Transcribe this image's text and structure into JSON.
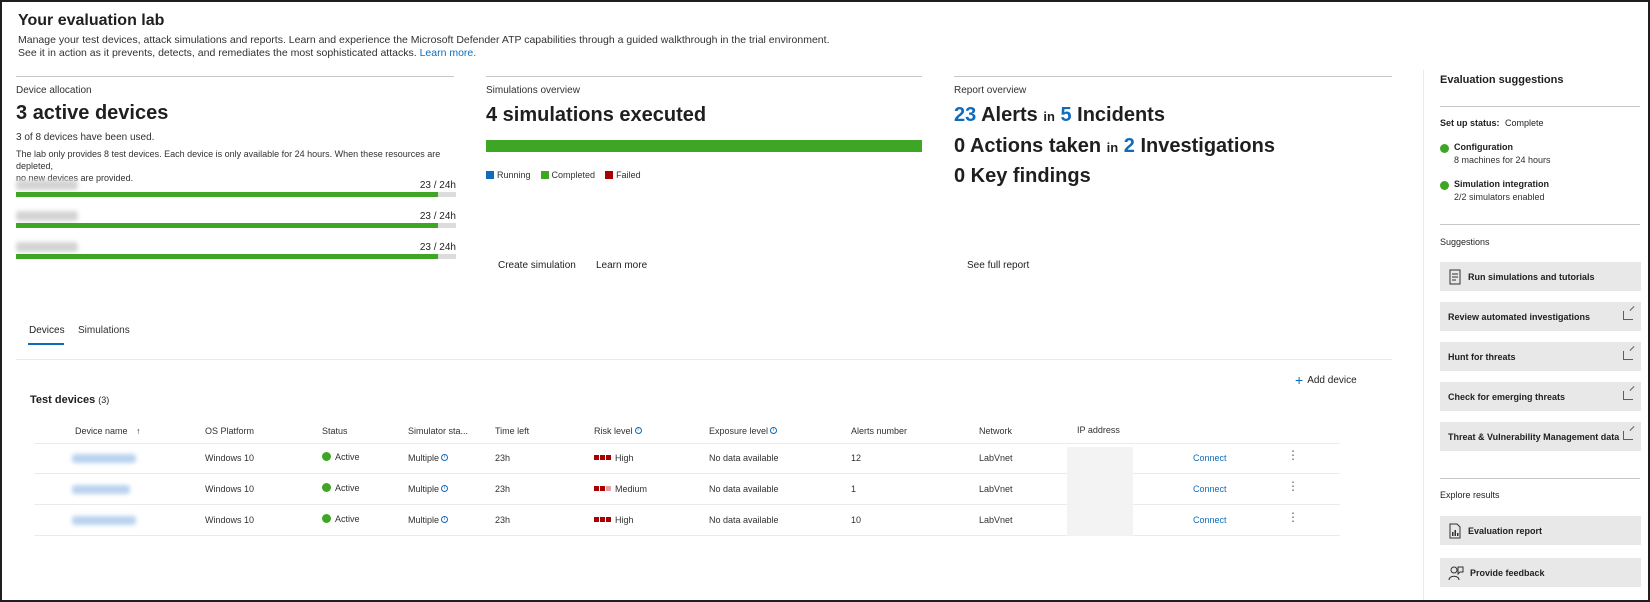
{
  "header": {
    "title": "Your evaluation lab",
    "intro_line1": "Manage your test devices, attack simulations and reports. Learn and experience the Microsoft Defender ATP capabilities through a guided walkthrough in the trial environment.",
    "intro_line2": "See it in action as it prevents, detects, and remediates the most sophisticated attacks.",
    "learn_more": "Learn more."
  },
  "device_allocation": {
    "label": "Device allocation",
    "headline_num": "3",
    "headline_text": "active devices",
    "used_text": "3 of 8 devices have been used.",
    "note_line1": "The lab only provides 8 test devices. Each device is only available for 24 hours. When these resources are depleted,",
    "note_line2": "no new devices are provided.",
    "devices": [
      {
        "time": "23 / 24h",
        "progress": 0.958
      },
      {
        "time": "23 / 24h",
        "progress": 0.958
      },
      {
        "time": "23 / 24h",
        "progress": 0.958
      }
    ]
  },
  "simulations_overview": {
    "label": "Simulations overview",
    "headline": "4 simulations executed",
    "completed_fraction": 1.0,
    "legend": [
      {
        "label": "Running",
        "color": "#0f6cbd"
      },
      {
        "label": "Completed",
        "color": "#3fa625"
      },
      {
        "label": "Failed",
        "color": "#a80000"
      }
    ],
    "create_label": "Create simulation",
    "learn_more": "Learn more"
  },
  "report_overview": {
    "label": "Report overview",
    "alerts_num": "23",
    "alerts_text": "Alerts",
    "in1": "in",
    "incidents_num": "5",
    "incidents_text": "Incidents",
    "actions_text": "0 Actions taken",
    "in2": "in",
    "investigations_num": "2",
    "investigations_text": "Investigations",
    "findings_text": "0 Key findings",
    "full_report": "See full report"
  },
  "tabs": [
    {
      "label": "Devices",
      "active": true
    },
    {
      "label": "Simulations",
      "active": false
    }
  ],
  "add_device": "Add device",
  "table": {
    "title": "Test devices",
    "count": "(3)",
    "columns": [
      "Device name",
      "OS Platform",
      "Status",
      "Simulator sta...",
      "Time left",
      "Risk level",
      "Exposure level",
      "Alerts number",
      "Network",
      "IP address"
    ],
    "sort_icon": "↑",
    "rows": [
      {
        "os": "Windows 10",
        "status": "Active",
        "simulator": "Multiple",
        "time": "23h",
        "risk": "High",
        "risk_colors": [
          "#a80000",
          "#a80000",
          "#a80000"
        ],
        "exposure": "No data available",
        "alerts": "12",
        "network": "LabVnet",
        "action": "Connect"
      },
      {
        "os": "Windows 10",
        "status": "Active",
        "simulator": "Multiple",
        "time": "23h",
        "risk": "Medium",
        "risk_colors": [
          "#a80000",
          "#a80000",
          "#e8a0a0"
        ],
        "exposure": "No data available",
        "alerts": "1",
        "network": "LabVnet",
        "action": "Connect"
      },
      {
        "os": "Windows 10",
        "status": "Active",
        "simulator": "Multiple",
        "time": "23h",
        "risk": "High",
        "risk_colors": [
          "#a80000",
          "#a80000",
          "#a80000"
        ],
        "exposure": "No data available",
        "alerts": "10",
        "network": "LabVnet",
        "action": "Connect"
      }
    ]
  },
  "sidebar": {
    "title": "Evaluation suggestions",
    "setup_label": "Set up status:",
    "setup_value": "Complete",
    "status_items": [
      {
        "title": "Configuration",
        "sub": "8 machines for 24 hours"
      },
      {
        "title": "Simulation integration",
        "sub": "2/2 simulators enabled"
      }
    ],
    "suggestions_label": "Suggestions",
    "suggestions": [
      {
        "label": "Run simulations and tutorials",
        "icon": "document-icon"
      },
      {
        "label": "Review automated investigations",
        "icon": "external-link-icon"
      },
      {
        "label": "Hunt for threats",
        "icon": "external-link-icon"
      },
      {
        "label": "Check for emerging threats",
        "icon": "external-link-icon"
      },
      {
        "label": "Threat & Vulnerability Management data",
        "icon": "external-link-icon"
      }
    ],
    "explore_label": "Explore results",
    "explore": [
      {
        "label": "Evaluation report",
        "icon": "report-icon"
      },
      {
        "label": "Provide feedback",
        "icon": "feedback-icon"
      }
    ]
  },
  "colors": {
    "accent": "#0f6cbd",
    "success": "#3fa625",
    "danger": "#a80000"
  }
}
